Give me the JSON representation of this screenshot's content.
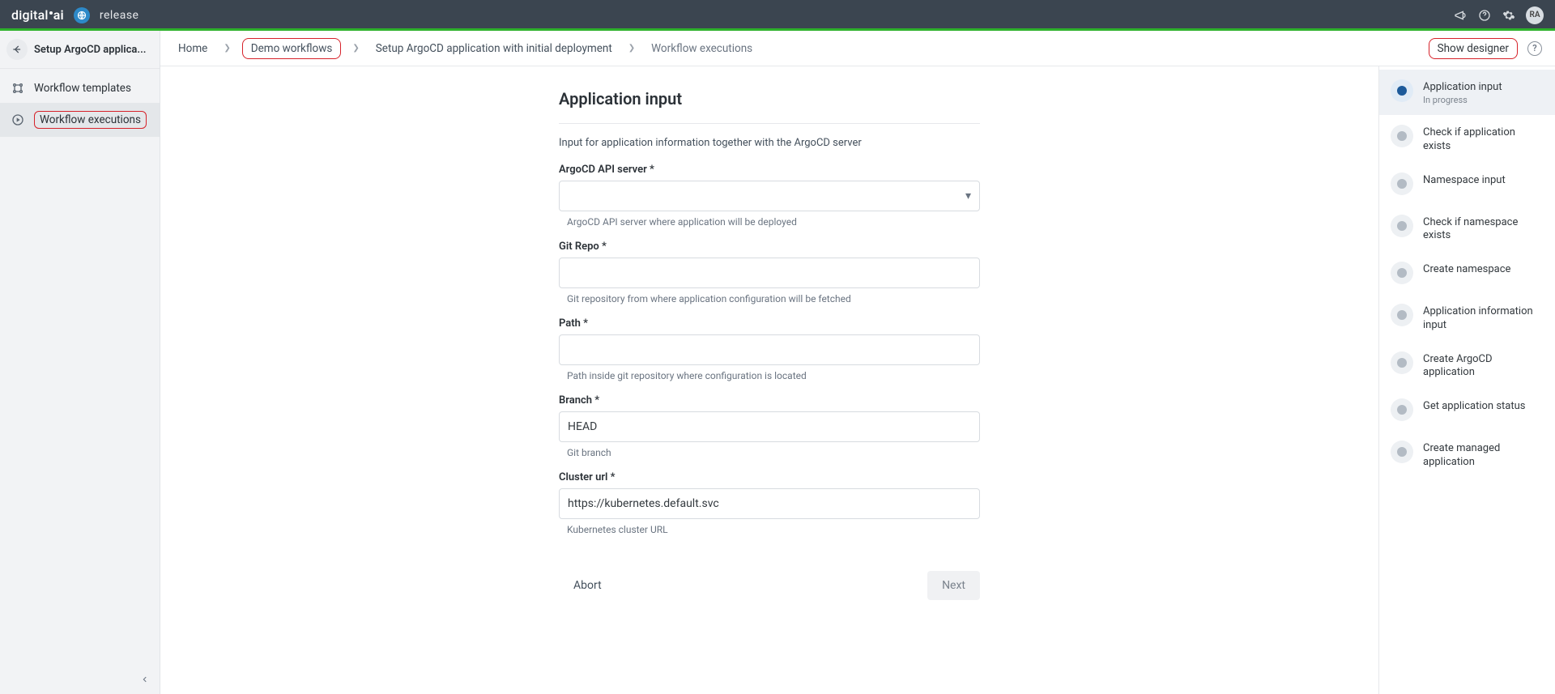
{
  "brand": {
    "name1": "digital",
    "name2": "ai",
    "product": "release"
  },
  "topbar": {
    "avatar_initials": "RA"
  },
  "sidebar": {
    "title": "Setup ArgoCD applica...",
    "items": [
      {
        "label": "Workflow templates"
      },
      {
        "label": "Workflow executions"
      }
    ]
  },
  "breadcrumbs": {
    "items": [
      {
        "label": "Home"
      },
      {
        "label": "Demo workflows"
      },
      {
        "label": "Setup ArgoCD application with initial deployment"
      },
      {
        "label": "Workflow executions"
      }
    ]
  },
  "actions": {
    "show_designer": "Show designer"
  },
  "form": {
    "title": "Application input",
    "description": "Input for application information together with the ArgoCD server",
    "fields": {
      "api_server": {
        "label": "ArgoCD API server *",
        "value": "",
        "hint": "ArgoCD API server where application will be deployed"
      },
      "git_repo": {
        "label": "Git Repo *",
        "value": "",
        "hint": "Git repository from where application configuration will be fetched"
      },
      "path": {
        "label": "Path *",
        "value": "",
        "hint": "Path inside git repository where configuration is located"
      },
      "branch": {
        "label": "Branch *",
        "value": "HEAD",
        "hint": "Git branch"
      },
      "cluster": {
        "label": "Cluster url *",
        "value": "https://kubernetes.default.svc",
        "hint": "Kubernetes cluster URL"
      }
    },
    "buttons": {
      "abort": "Abort",
      "next": "Next"
    }
  },
  "steps": [
    {
      "label": "Application input",
      "sub": "In progress",
      "active": true
    },
    {
      "label": "Check if application exists"
    },
    {
      "label": "Namespace input"
    },
    {
      "label": "Check if namespace exists"
    },
    {
      "label": "Create namespace"
    },
    {
      "label": "Application information input"
    },
    {
      "label": "Create ArgoCD application"
    },
    {
      "label": "Get application status"
    },
    {
      "label": "Create managed application"
    }
  ]
}
